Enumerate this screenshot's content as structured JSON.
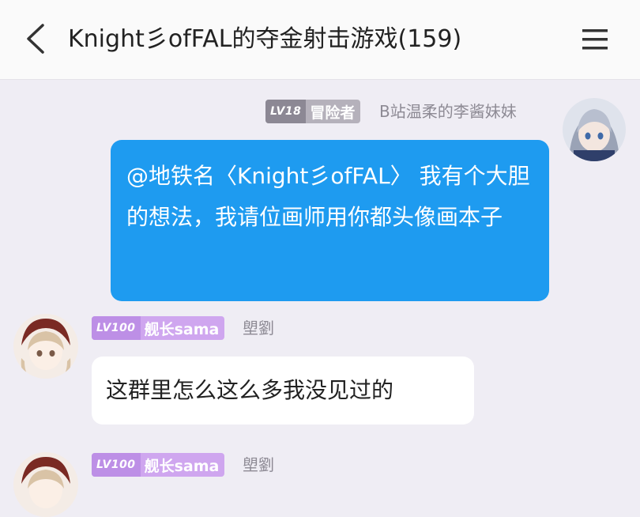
{
  "header": {
    "title": "Knight彡ofFAL的夺金射击游戏(159)",
    "back_icon": "chevron-left-icon",
    "menu_icon": "hamburger-menu-icon"
  },
  "messages": [
    {
      "side": "right",
      "level": "LV18",
      "badge_title": "冒险者",
      "sender": "B站温柔的李酱妹妹",
      "text": "@地铁名〈Knight彡ofFAL〉 我有个大胆的想法，我请位画师用你都头像画本子"
    },
    {
      "side": "left",
      "level": "LV100",
      "badge_title": "舰长sama",
      "sender": "塱劉",
      "text": "这群里怎么这么多我没见过的"
    },
    {
      "side": "left",
      "level": "LV100",
      "badge_title": "舰长sama",
      "sender": "塱劉",
      "text": ""
    }
  ],
  "colors": {
    "background": "#efedf4",
    "self_bubble": "#1e9bf0",
    "other_bubble": "#ffffff",
    "badge_gray": "#b5b1bb",
    "badge_purple": "#cfa6ef"
  }
}
